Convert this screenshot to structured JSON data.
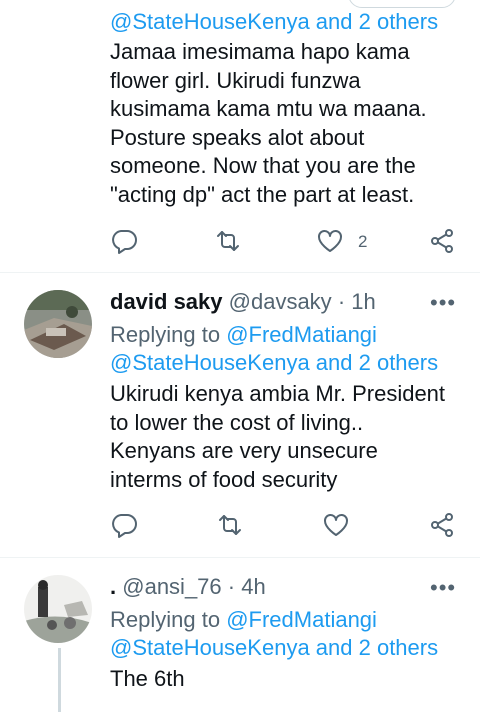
{
  "top_tweet": {
    "cut_line": "@StateHouseKenya and 2 others",
    "body_lines": [
      "Jamaa imesimama hapo kama",
      "flower girl. Ukirudi funzwa",
      "kusimama kama mtu wa maana.",
      "Posture speaks alot about",
      "someone. Now that you are the",
      "\"acting dp\" act the part at least."
    ],
    "like_count": "2"
  },
  "tweets": [
    {
      "name": "david saky",
      "handle": "@davsaky",
      "dot": "·",
      "time": "1h",
      "replying_prefix": "Replying to",
      "replying_to_1": "@FredMatiangi",
      "replying_to_2": "@StateHouseKenya and 2 others",
      "body_lines": [
        "Ukirudi kenya ambia Mr. President",
        "to lower the cost of living..",
        "Kenyans are very unsecure",
        "interms of food security"
      ]
    },
    {
      "name": ".",
      "handle": "@ansi_76",
      "dot": "·",
      "time": "4h",
      "replying_prefix": "Replying to",
      "replying_to_1": "@FredMatiangi",
      "replying_to_2": "@StateHouseKenya and 2 others",
      "body_lines": [
        "The 6th"
      ]
    }
  ],
  "more_glyph": "•••",
  "icons": [
    "reply-icon",
    "retweet-icon",
    "like-icon",
    "share-icon",
    "more-icon"
  ],
  "colors": {
    "link": "#1d9bf0",
    "muted": "#536471",
    "text": "#0f1419",
    "divider": "#eff3f4"
  }
}
